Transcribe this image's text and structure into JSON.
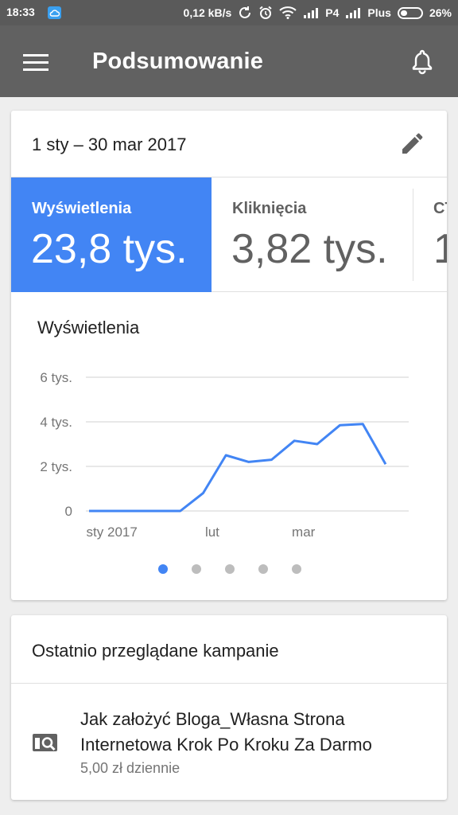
{
  "status_bar": {
    "time": "18:33",
    "speed": "0,12 kB/s",
    "carrier1": "P4",
    "carrier2": "Plus",
    "battery": "26%",
    "icons": [
      "cloud-icon",
      "sync-icon",
      "alarm-icon",
      "wifi-icon",
      "signal-icon",
      "signal-icon",
      "battery-icon"
    ]
  },
  "app_bar": {
    "title": "Podsumowanie",
    "menu_icon": "menu-icon",
    "bell_icon": "bell-icon"
  },
  "summary": {
    "date_range": "1 sty – 30 mar 2017",
    "edit_icon": "edit-icon",
    "metrics": [
      {
        "label": "Wyświetlenia",
        "value": "23,8 tys.",
        "selected": true
      },
      {
        "label": "Kliknięcia",
        "value": "3,82 tys.",
        "selected": false
      },
      {
        "label": "CT",
        "value": "1",
        "selected": false
      }
    ],
    "chart_title": "Wyświetlenia",
    "pager_count": 5,
    "pager_active": 0
  },
  "chart_data": {
    "type": "line",
    "title": "Wyświetlenia",
    "y_ticks": [
      {
        "value": 0,
        "label": "0"
      },
      {
        "value": 2000,
        "label": "2 tys."
      },
      {
        "value": 4000,
        "label": "4 tys."
      },
      {
        "value": 6000,
        "label": "6 tys."
      }
    ],
    "x_ticks": [
      {
        "week": 1,
        "label": "sty 2017"
      },
      {
        "week": 5.4,
        "label": "lut"
      },
      {
        "week": 9.4,
        "label": "mar"
      }
    ],
    "ylim": [
      0,
      6000
    ],
    "xlim": [
      0,
      14.5
    ],
    "grid": true,
    "color": "#4285f4",
    "series": [
      {
        "x": [
          0,
          1,
          2,
          3,
          4,
          5,
          6,
          7,
          8,
          9,
          10,
          11,
          12,
          13
        ],
        "values": [
          0,
          0,
          0,
          0,
          0,
          800,
          2500,
          2200,
          2300,
          3150,
          3000,
          3850,
          3900,
          2100
        ]
      }
    ]
  },
  "recent": {
    "title": "Ostatnio przeglądane kampanie",
    "campaign_name": "Jak założyć Bloga_Własna Strona Internetowa Krok Po Kroku Za Darmo",
    "campaign_budget": "5,00 zł dziennie",
    "campaign_icon": "search-campaign-icon"
  }
}
